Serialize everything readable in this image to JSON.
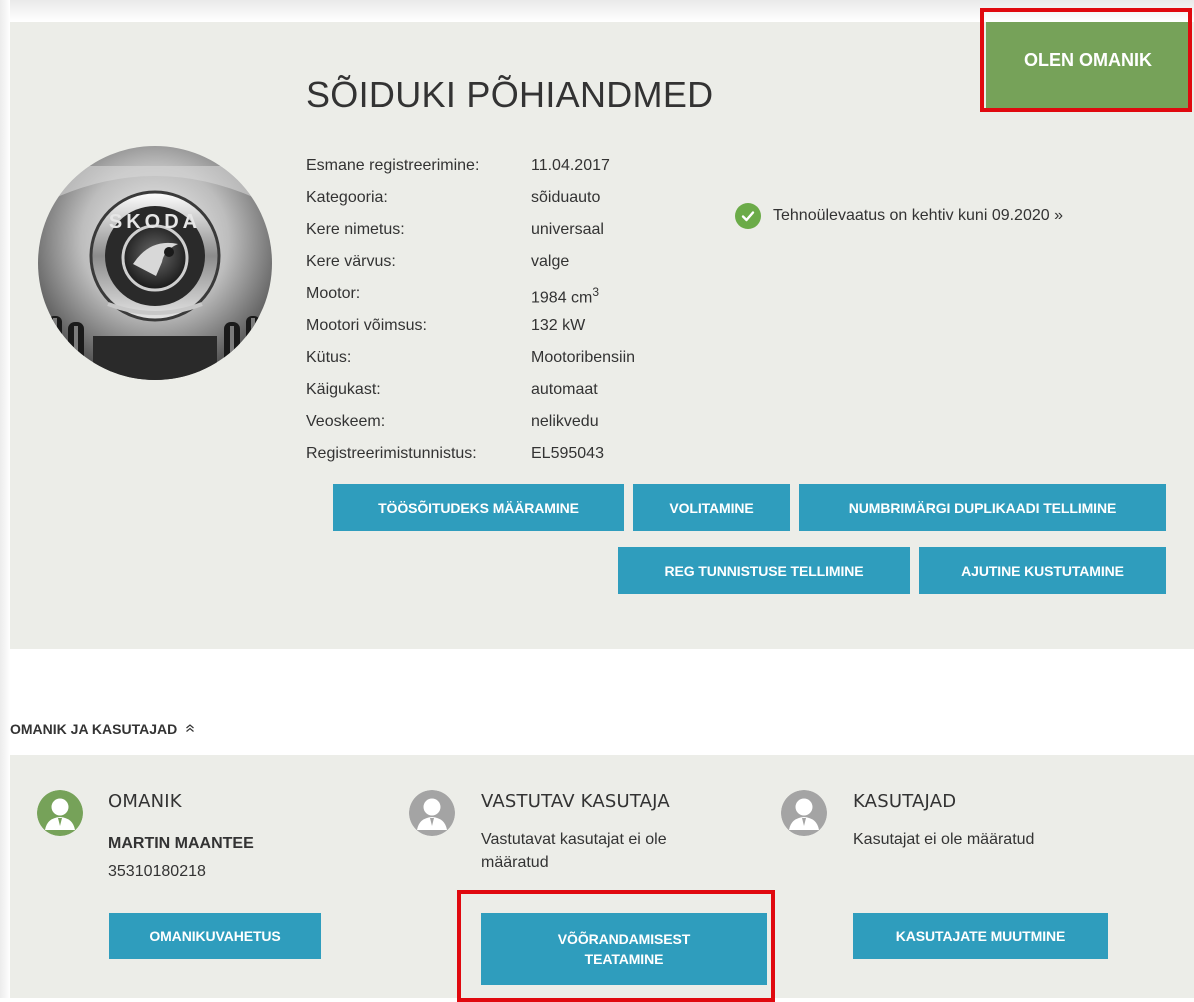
{
  "colors": {
    "owner_cta": "#76a259",
    "action_button": "#2f9dbd",
    "panel": "#ecede8",
    "highlight": "#e0090f",
    "check": "#6bab48"
  },
  "header": {
    "owner_button": "OLEN OMANIK",
    "title": "SÕIDUKI PÕHIANDMED"
  },
  "car_logo_text": "SKODA",
  "specs": [
    {
      "label": "Esmane registreerimine:",
      "value": "11.04.2017"
    },
    {
      "label": "Kategooria:",
      "value": "sõiduauto"
    },
    {
      "label": "Kere nimetus:",
      "value": "universaal"
    },
    {
      "label": "Kere värvus:",
      "value": "valge"
    },
    {
      "label": "Mootor:",
      "value": "1984 cm",
      "sup": "3"
    },
    {
      "label": "Mootori võimsus:",
      "value": "132 kW"
    },
    {
      "label": "Kütus:",
      "value": "Mootoribensiin"
    },
    {
      "label": "Käigukast:",
      "value": "automaat"
    },
    {
      "label": "Veoskeem:",
      "value": "nelikvedu"
    },
    {
      "label": "Registreerimistunnistus:",
      "value": "EL595043"
    }
  ],
  "inspection": {
    "text": "Tehnoülevaatus on kehtiv kuni 09.2020 »",
    "icon": "check-circle-icon"
  },
  "actions": {
    "work_trips": "TÖÖSÕITUDEKS MÄÄRAMINE",
    "authorization": "VOLITAMINE",
    "plate_duplicate": "NUMBRIMÄRGI DUPLIKAADI TELLIMINE",
    "reg_certificate": "REG TUNNISTUSE TELLIMINE",
    "temp_delete": "AJUTINE KUSTUTAMINE"
  },
  "owners_section": {
    "heading": "OMANIK JA KASUTAJAD",
    "toggle_icon": "«",
    "owner": {
      "title": "OMANIK",
      "name": "MARTIN MAANTEE",
      "id": "35310180218",
      "button": "OMANIKUVAHETUS",
      "icon": "person-icon"
    },
    "responsible": {
      "title": "VASTUTAV KASUTAJA",
      "text_line1": "Vastutavat kasutajat ei ole",
      "text_line2": "määratud",
      "button_line1": "VÕÕRANDAMISEST",
      "button_line2": "TEATAMINE",
      "icon": "person-icon"
    },
    "users": {
      "title": "KASUTAJAD",
      "text": "Kasutajat ei ole määratud",
      "button": "KASUTAJATE MUUTMINE",
      "icon": "person-icon"
    }
  }
}
